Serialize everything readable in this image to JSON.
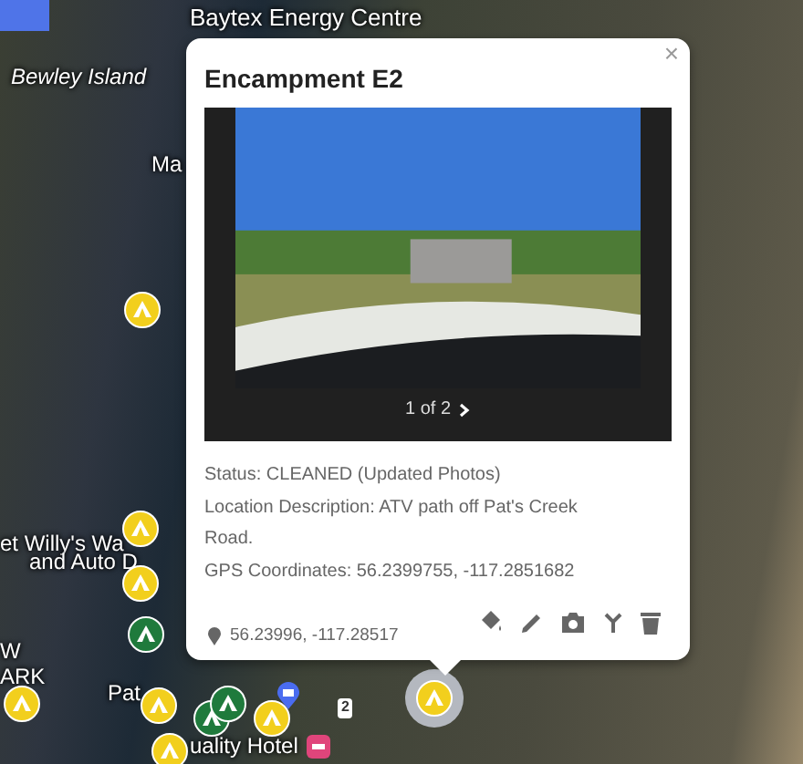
{
  "map": {
    "labels": [
      {
        "text": "Baytex Energy Centre",
        "italic": false
      },
      {
        "text": "Bewley Island",
        "italic": true
      },
      {
        "text": "Ma",
        "italic": false
      },
      {
        "text": "et Willy's Wa",
        "italic": false
      },
      {
        "text": "and Auto D",
        "italic": false
      },
      {
        "text": "W",
        "italic": false
      },
      {
        "text": "ARK",
        "italic": false
      },
      {
        "text": "Pat",
        "italic": false
      },
      {
        "text": "uality Hotel",
        "italic": false
      },
      {
        "text": "2",
        "italic": false
      }
    ],
    "markers": [
      {
        "color": "#f2cf1d",
        "selected": false
      },
      {
        "color": "#f2cf1d",
        "selected": false
      },
      {
        "color": "#f2cf1d",
        "selected": false
      },
      {
        "color": "#1f7a3c",
        "selected": false
      },
      {
        "color": "#f2cf1d",
        "selected": false
      },
      {
        "color": "#f2cf1d",
        "selected": false
      },
      {
        "color": "#1f7a3c",
        "selected": false
      },
      {
        "color": "#1f7a3c",
        "selected": false
      },
      {
        "color": "#f2cf1d",
        "selected": false
      },
      {
        "color": "#f2cf1d",
        "selected": false
      },
      {
        "color": "#f2cf1d",
        "selected": true
      }
    ]
  },
  "popup": {
    "title": "Encampment E2",
    "close": "×",
    "pager": "1 of 2",
    "details": [
      "Status: CLEANED (Updated Photos)",
      "Location Description: ATV path off Pat's Creek Road.",
      "GPS Coordinates: 56.2399755, -117.2851682"
    ],
    "location": "56.23996, -117.28517",
    "actions": [
      {
        "kind": "style"
      },
      {
        "kind": "edit"
      },
      {
        "kind": "photo"
      },
      {
        "kind": "split"
      },
      {
        "kind": "delete"
      }
    ]
  }
}
